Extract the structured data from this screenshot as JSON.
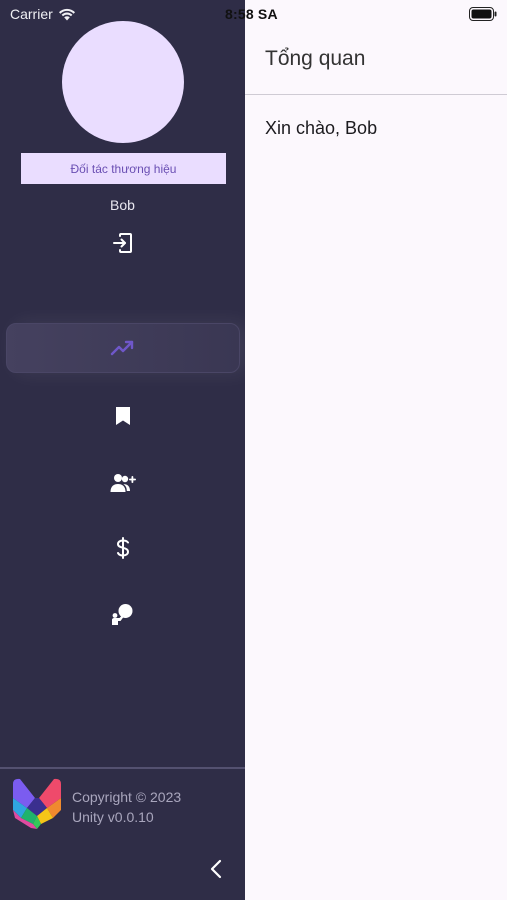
{
  "status_bar": {
    "carrier": "Carrier",
    "time": "8:58 SA"
  },
  "sidebar": {
    "role_badge": "Đối tác thương hiệu",
    "username": "Bob",
    "nav_items": [
      {
        "icon": "trending-up-icon",
        "active": true
      },
      {
        "icon": "bookmark-icon",
        "active": false
      },
      {
        "icon": "add-user-icon",
        "active": false
      },
      {
        "icon": "dollar-icon",
        "active": false
      },
      {
        "icon": "presenter-icon",
        "active": false
      }
    ],
    "footer": {
      "copyright": "Copyright © 2023",
      "version": "Unity v0.0.10"
    }
  },
  "main": {
    "title": "Tổng quan",
    "greeting": "Xin chào, Bob"
  },
  "colors": {
    "sidebar_bg": "#2f2d47",
    "accent_light": "#eaddff",
    "accent": "#6a4fb3",
    "content_bg": "#fcf8fd"
  }
}
